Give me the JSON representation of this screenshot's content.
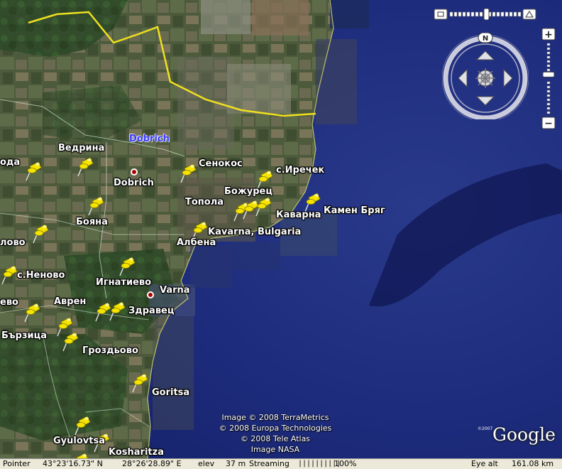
{
  "map": {
    "country_region_label": "Dobrich",
    "place_labels": [
      {
        "key": "vedrina",
        "text": "Ведрина"
      },
      {
        "key": "oda",
        "text": "ода"
      },
      {
        "key": "dobrich",
        "text": "Dobrich"
      },
      {
        "key": "senokos",
        "text": "Сенокос"
      },
      {
        "key": "irechek",
        "text": "с.Иречек"
      },
      {
        "key": "bozhurets",
        "text": "Божурец"
      },
      {
        "key": "topola",
        "text": "Топола"
      },
      {
        "key": "kavarna_bg",
        "text": "Каварна"
      },
      {
        "key": "kamen_bryag",
        "text": "Камен Бряг"
      },
      {
        "key": "boyana",
        "text": "Бояна"
      },
      {
        "key": "kavarna",
        "text": "Kavarna, Bulgaria"
      },
      {
        "key": "lovo",
        "text": "лово"
      },
      {
        "key": "albena",
        "text": "Албена"
      },
      {
        "key": "nenovo",
        "text": "с.Неново"
      },
      {
        "key": "ignatievo",
        "text": "Игнатиево"
      },
      {
        "key": "varna",
        "text": "Varna"
      },
      {
        "key": "evo",
        "text": "ево"
      },
      {
        "key": "avren",
        "text": "Аврен"
      },
      {
        "key": "zdravets",
        "text": "Здравец"
      },
      {
        "key": "barzitsa",
        "text": "Бързица"
      },
      {
        "key": "grozdyovo",
        "text": "Гроздьово"
      },
      {
        "key": "goritsa",
        "text": "Goritsa"
      },
      {
        "key": "gyulovtsa",
        "text": "Gyulovtsa"
      },
      {
        "key": "kosharitza",
        "text": "Kosharitza"
      }
    ],
    "pin_color": "#f5e400",
    "border_color": "#f0e020",
    "sea_color": "#1a2a78"
  },
  "credits": {
    "line1": "Image © 2008 TerraMetrics",
    "line2": "© 2008 Europa Technologies",
    "line3": "© 2008 Tele Atlas",
    "line4": "Image NASA"
  },
  "logo": {
    "text": "Google",
    "copyright": "©2007"
  },
  "status": {
    "pointer_label": "Pointer",
    "latitude": "43°23'16.73\" N",
    "longitude": "28°26'28.89\" E",
    "elev_label": "elev",
    "elev_value": "37 m",
    "streaming_label": "Streaming",
    "streaming_bars": "||||||||||",
    "streaming_percent": "100%",
    "eye_alt_label": "Eye alt",
    "eye_alt_value": "161.08 km"
  },
  "controls": {
    "north_label": "N",
    "zoom_in": "+",
    "zoom_out": "−",
    "zoom_level": 0.58,
    "tilt_level": 0.5
  }
}
